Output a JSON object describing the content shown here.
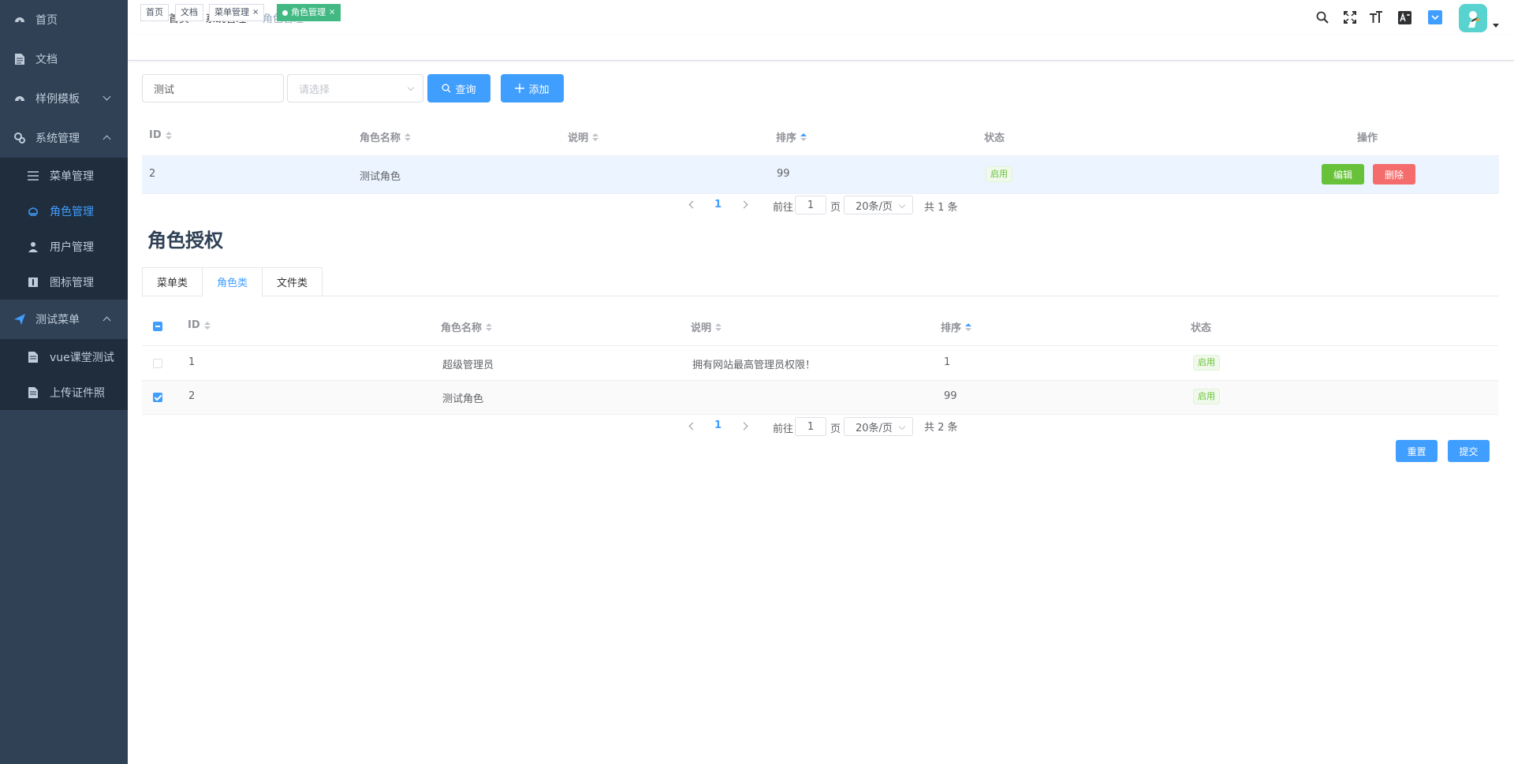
{
  "sidebar": {
    "items": [
      {
        "label": "首页",
        "icon": "dashboard-icon"
      },
      {
        "label": "文档",
        "icon": "document-icon"
      },
      {
        "label": "样例模板",
        "icon": "template-icon"
      },
      {
        "label": "系统管理",
        "icon": "settings-icon"
      },
      {
        "label": "测试菜单",
        "icon": "send-icon"
      }
    ],
    "system_sub": [
      {
        "label": "菜单管理",
        "icon": "list-icon"
      },
      {
        "label": "角色管理",
        "icon": "role-icon"
      },
      {
        "label": "用户管理",
        "icon": "user-icon"
      },
      {
        "label": "图标管理",
        "icon": "info-icon"
      }
    ],
    "test_sub": [
      {
        "label": "vue课堂测试",
        "icon": "file-icon"
      },
      {
        "label": "上传证件照",
        "icon": "file-icon"
      }
    ]
  },
  "breadcrumb": {
    "home": "首页",
    "sep1": "/",
    "level2": "系统管理",
    "sep2": "/",
    "current": "角色管理"
  },
  "tags": [
    {
      "label": "首页"
    },
    {
      "label": "文档"
    },
    {
      "label": "菜单管理",
      "close": "×"
    },
    {
      "label": "角色管理",
      "close": "×"
    }
  ],
  "search": {
    "keyword": "测试",
    "select_placeholder": "请选择",
    "query_label": "查询",
    "add_label": "添加"
  },
  "role_table": {
    "headers": [
      "ID",
      "角色名称",
      "说明",
      "排序",
      "状态",
      "操作"
    ],
    "rows": [
      {
        "id": "2",
        "name": "测试角色",
        "desc": "",
        "sort": "99",
        "status": "启用",
        "edit": "编辑",
        "delete": "删除"
      }
    ],
    "pagination": {
      "page": "1",
      "goto_prefix": "前往",
      "goto_value": "1",
      "goto_suffix": "页",
      "page_size": "20条/页",
      "total": "共 1 条"
    }
  },
  "auth": {
    "title": "角色授权",
    "tabs": [
      "菜单类",
      "角色类",
      "文件类"
    ],
    "headers": [
      "ID",
      "角色名称",
      "说明",
      "排序",
      "状态"
    ],
    "rows": [
      {
        "id": "1",
        "name": "超级管理员",
        "desc": "拥有网站最高管理员权限！",
        "sort": "1",
        "status": "启用",
        "checked": false
      },
      {
        "id": "2",
        "name": "测试角色",
        "desc": "",
        "sort": "99",
        "status": "启用",
        "checked": true
      }
    ],
    "pagination": {
      "page": "1",
      "goto_prefix": "前往",
      "goto_value": "1",
      "goto_suffix": "页",
      "page_size": "20条/页",
      "total": "共 2 条"
    },
    "reset_label": "重置",
    "submit_label": "提交"
  },
  "colors": {
    "sidebar": "#304156",
    "primary": "#409eff",
    "success": "#67c23a",
    "danger": "#f56c6c",
    "tag_active": "#42b983"
  }
}
